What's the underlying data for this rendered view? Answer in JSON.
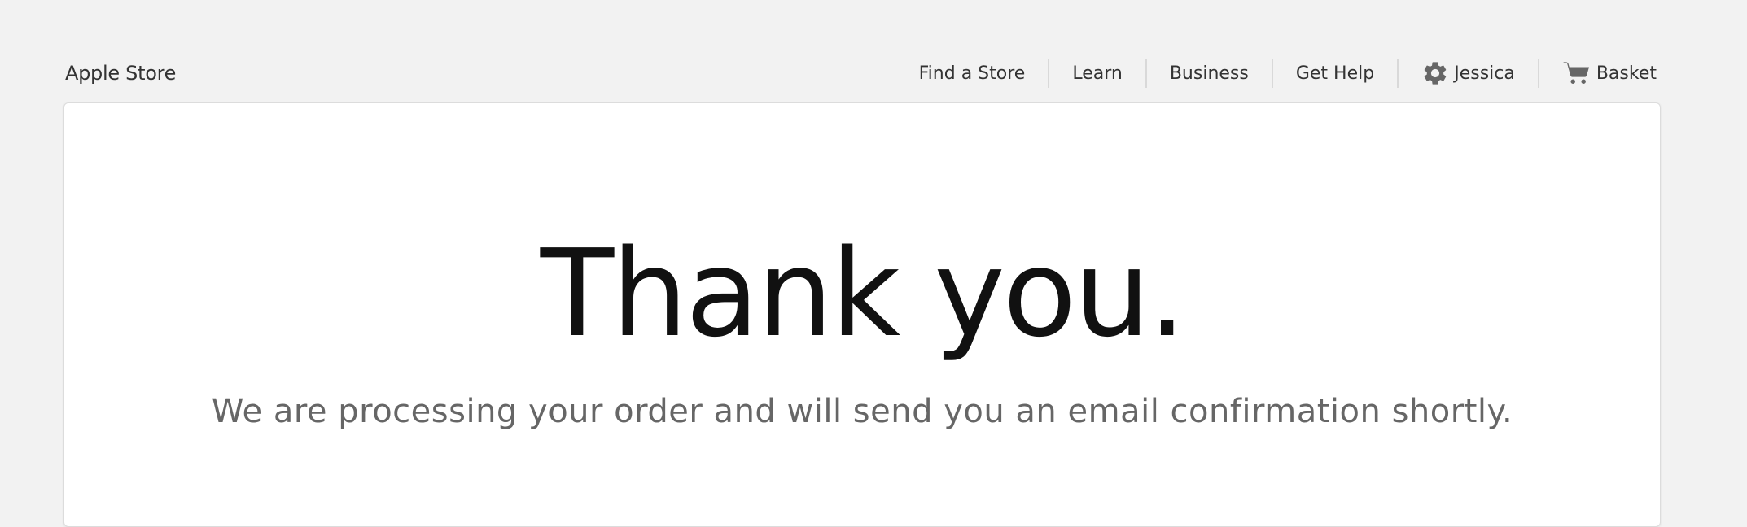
{
  "header": {
    "brand": "Apple Store",
    "nav": {
      "find_store": "Find a Store",
      "learn": "Learn",
      "business": "Business",
      "get_help": "Get Help",
      "account": {
        "icon": "gear-icon",
        "label": "Jessica"
      },
      "basket": {
        "icon": "cart-icon",
        "label": "Basket"
      }
    }
  },
  "main": {
    "title": "Thank you.",
    "subtitle": "We are processing your order and will send you an email confirmation shortly."
  },
  "colors": {
    "background": "#f2f2f2",
    "panel": "#ffffff",
    "nav_text": "#333333",
    "title_text": "#111111",
    "subtitle_text": "#666666",
    "icon_fill": "#666666"
  }
}
